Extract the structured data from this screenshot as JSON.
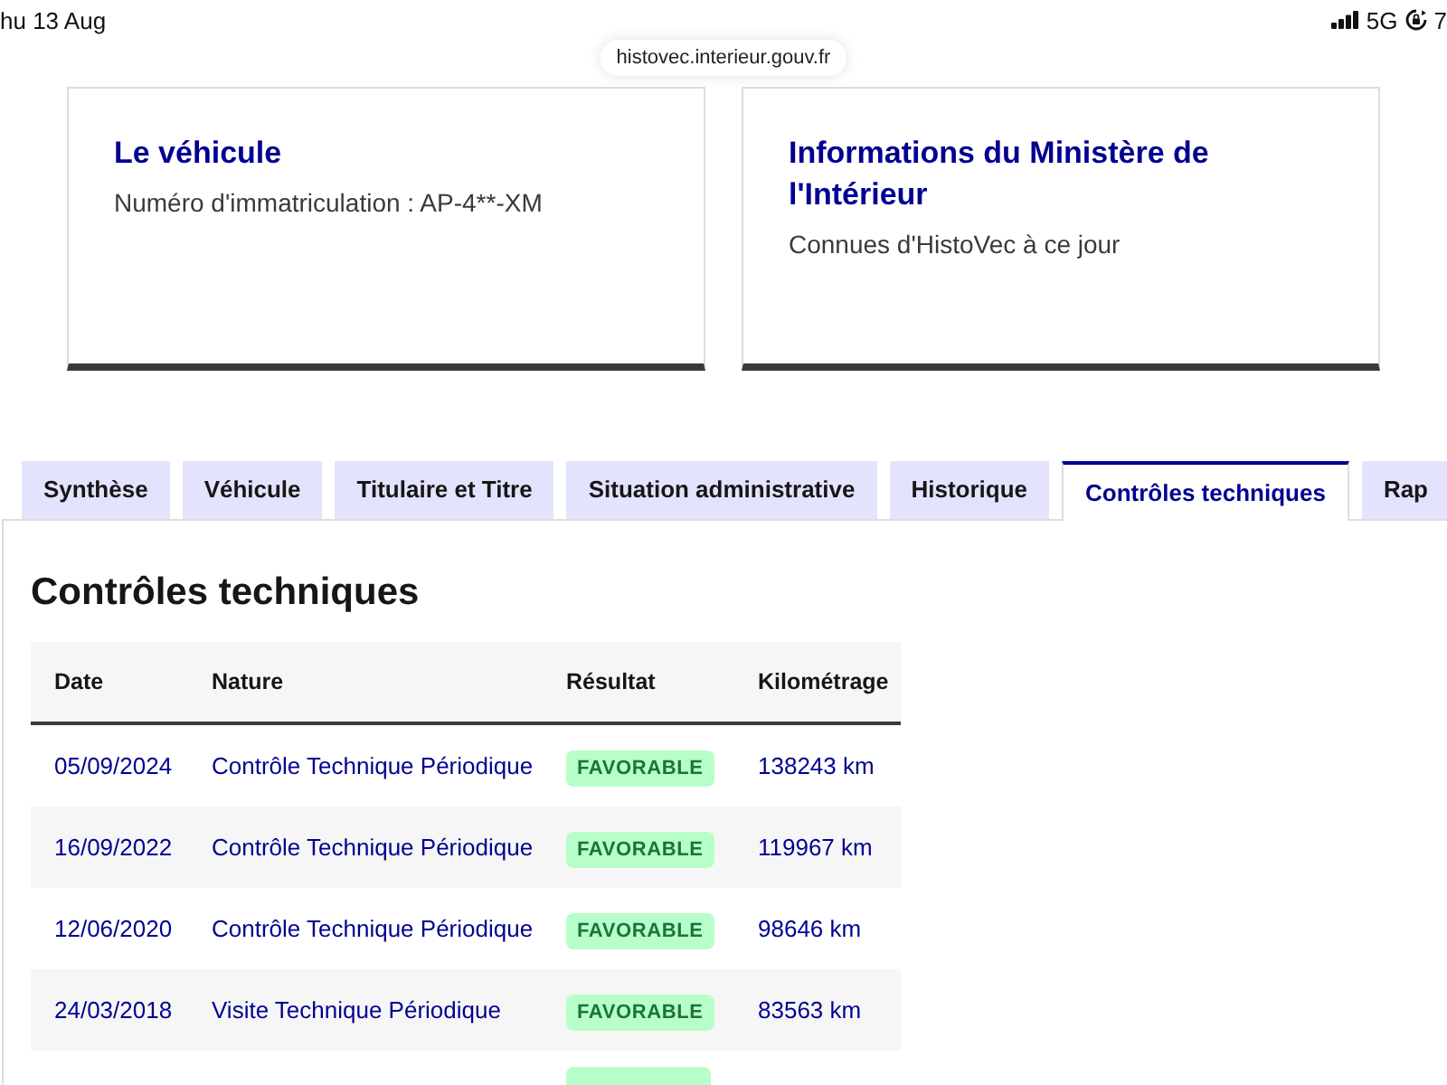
{
  "status_bar": {
    "date": "hu 13 Aug",
    "network": "5G",
    "battery": "7"
  },
  "address_bar": {
    "url": "histovec.interieur.gouv.fr"
  },
  "cards": [
    {
      "title": "Le véhicule",
      "subtitle": "Numéro d'immatriculation : AP-4**-XM"
    },
    {
      "title": "Informations du Ministère de l'Intérieur",
      "subtitle": "Connues d'HistoVec à ce jour"
    }
  ],
  "tabs": [
    {
      "label": "Synthèse",
      "selected": false
    },
    {
      "label": "Véhicule",
      "selected": false
    },
    {
      "label": "Titulaire et Titre",
      "selected": false
    },
    {
      "label": "Situation administrative",
      "selected": false
    },
    {
      "label": "Historique",
      "selected": false
    },
    {
      "label": "Contrôles techniques",
      "selected": true
    },
    {
      "label": "Rap",
      "selected": false
    }
  ],
  "section": {
    "title": "Contrôles techniques",
    "table": {
      "columns": [
        "Date",
        "Nature",
        "Résultat",
        "Kilométrage"
      ],
      "rows": [
        {
          "date": "05/09/2024",
          "nature": "Contrôle Technique Périodique",
          "result": "FAVORABLE",
          "mileage": "138243 km"
        },
        {
          "date": "16/09/2022",
          "nature": "Contrôle Technique Périodique",
          "result": "FAVORABLE",
          "mileage": "119967 km"
        },
        {
          "date": "12/06/2020",
          "nature": "Contrôle Technique Périodique",
          "result": "FAVORABLE",
          "mileage": "98646 km"
        },
        {
          "date": "24/03/2018",
          "nature": "Visite Technique Périodique",
          "result": "FAVORABLE",
          "mileage": "83563 km"
        }
      ],
      "cut_off_row": true
    }
  }
}
